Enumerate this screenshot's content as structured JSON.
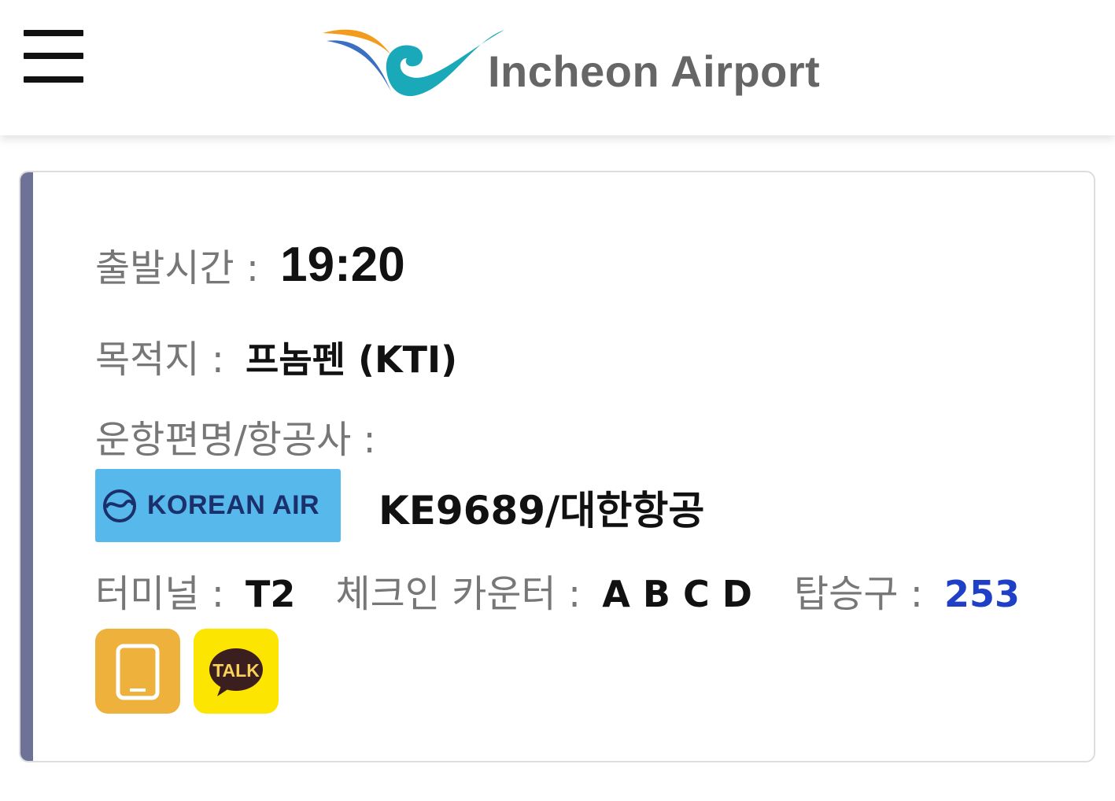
{
  "header": {
    "menu_icon": "hamburger-menu-icon",
    "logo_text": "Incheon Airport",
    "logo_colors": {
      "swoosh_orange": "#f29b1d",
      "swoosh_blue": "#3a6fc4",
      "swoosh_teal": "#1aa9b8",
      "text": "#666666"
    }
  },
  "flight": {
    "departure_label": "출발시간 :",
    "departure_time": "19:20",
    "destination_label": "목적지 :",
    "destination": "프놈펜 (KTI)",
    "flight_airline_label": "운항편명/항공사 :",
    "airline_logo_text": "KOREAN AIR",
    "airline_logo_color": "#57b9eb",
    "flight_code": "KE9689/대한항공",
    "terminal_label": "터미널 :",
    "terminal": "T2",
    "checkin_label": "체크인 카운터 :",
    "checkin_counters": "A B C D",
    "gate_label": "탑승구 :",
    "gate": "253",
    "gate_color": "#1f3fc7"
  },
  "actions": {
    "phone_icon": "mobile-phone-icon",
    "phone_color": "#edb13c",
    "kakaotalk_icon": "kakaotalk-icon",
    "kakaotalk_text": "TALK",
    "kakaotalk_color": "#fce500"
  },
  "card_accent_color": "#6d7296"
}
